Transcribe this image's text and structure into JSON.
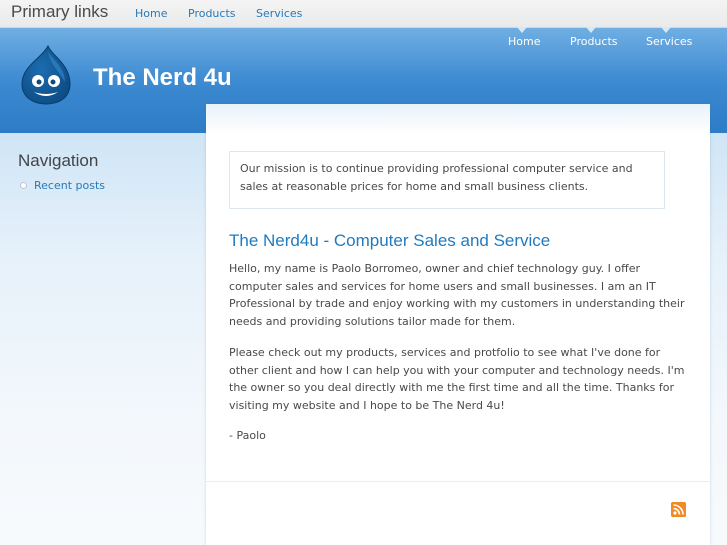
{
  "topbar": {
    "title": "Primary links",
    "links": [
      "Home",
      "Products",
      "Services"
    ]
  },
  "header": {
    "site_name": "The Nerd 4u",
    "nav": [
      "Home",
      "Products",
      "Services"
    ],
    "logo_icon": "drupal-drop-icon"
  },
  "sidebar": {
    "title": "Navigation",
    "items": [
      {
        "label": "Recent posts"
      }
    ]
  },
  "content": {
    "mission": "Our mission is to continue providing professional computer service and sales at reasonable prices for home and small business clients.",
    "node_title": "The Nerd4u - Computer Sales and Service",
    "paragraphs": [
      "Hello, my name is Paolo Borromeo, owner and chief technology guy. I offer computer sales and services for home users and small businesses. I am an IT Professional by trade and enjoy working with my customers in understanding their needs and providing solutions tailor made for them.",
      "Please check out my products, services and protfolio to see what I've done for other client and how I can help you with your computer and technology needs. I'm the owner so you deal directly with me the first time and all the time. Thanks for visiting my website and I hope to be The Nerd 4u!"
    ],
    "signoff": "- Paolo",
    "feed_icon": "rss-feed-icon"
  },
  "colors": {
    "header_blue": "#3d8bd2",
    "link_blue": "#2779b9",
    "title_blue": "#1f7bbf",
    "rss_orange": "#f08a24"
  }
}
